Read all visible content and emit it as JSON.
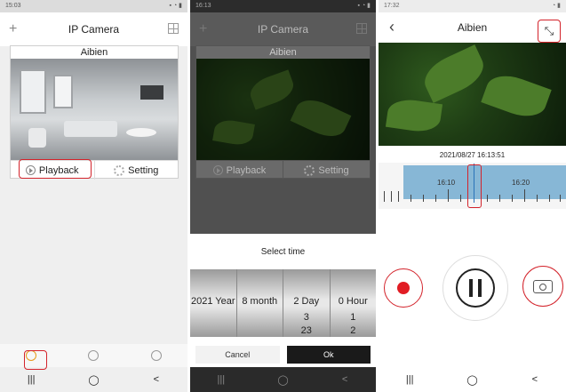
{
  "phone1": {
    "status_time": "15:03",
    "title": "IP Camera",
    "camera_name": "Aibien",
    "playback_label": "Playback",
    "setting_label": "Setting",
    "add_icon": "plus-icon",
    "grid_icon": "grid-icon"
  },
  "phone2": {
    "status_time": "16:13",
    "title": "IP Camera",
    "camera_name": "Aibien",
    "playback_label": "Playback",
    "setting_label": "Setting",
    "sheet_title": "Select time",
    "picker": {
      "columns": [
        {
          "selected": "2021 Year",
          "next": "",
          "next2": ""
        },
        {
          "selected": "8 month",
          "next": "",
          "next2": ""
        },
        {
          "selected": "2 Day",
          "next": "3",
          "next2": "23"
        },
        {
          "selected": "0 Hour",
          "next": "1",
          "next2": "2"
        }
      ]
    },
    "cancel_label": "Cancel",
    "ok_label": "Ok"
  },
  "phone3": {
    "status_time": "17:32",
    "title": "Aibien",
    "timestamp": "2021/08/27 16:13:51",
    "timeline_labels": [
      "16:10",
      "16:20"
    ]
  },
  "nav": {
    "recent": "|||",
    "home": "◯",
    "back": "<"
  }
}
